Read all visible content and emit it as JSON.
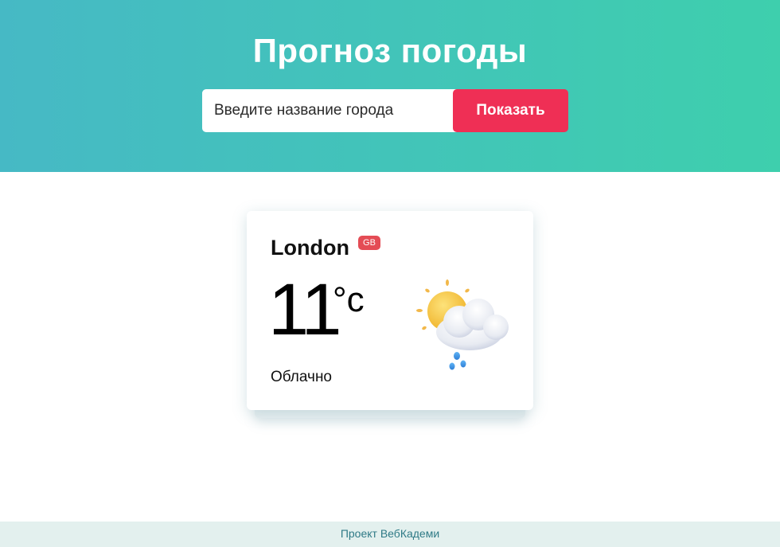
{
  "header": {
    "title": "Прогноз погоды",
    "search_placeholder": "Введите название города",
    "show_button_label": "Показать"
  },
  "weather_card": {
    "city": "London",
    "country_code": "GB",
    "temperature": "11",
    "temperature_unit": "°c",
    "description": "Облачно",
    "icon": "partly-cloudy-rain-icon"
  },
  "footer": {
    "text": "Проект ВебКадеми"
  },
  "colors": {
    "header_gradient_start": "#46b9c5",
    "header_gradient_end": "#3ecfad",
    "button": "#ef2f55",
    "badge": "#e44c55",
    "footer_background": "#e3f0ee",
    "footer_text": "#2f7a86"
  }
}
